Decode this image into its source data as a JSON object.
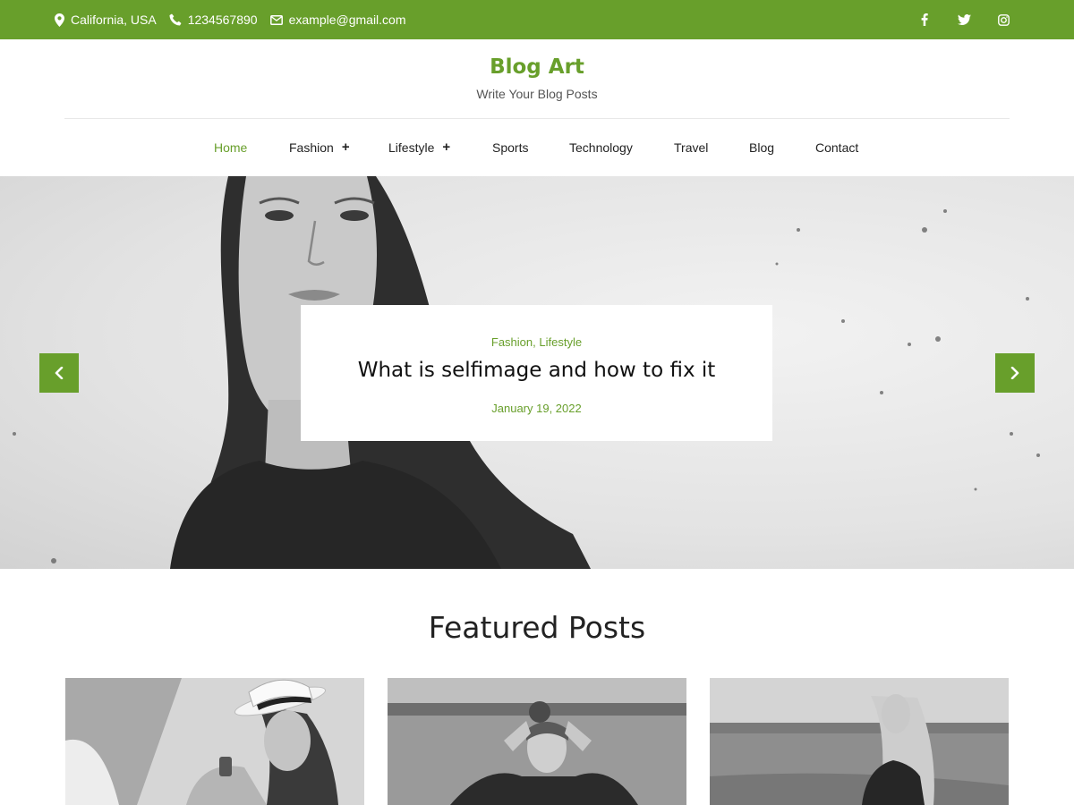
{
  "topbar": {
    "location": "California, USA",
    "phone": "1234567890",
    "email": "example@gmail.com",
    "social": [
      "facebook-icon",
      "twitter-icon",
      "instagram-icon"
    ],
    "bg_color": "#689f2b"
  },
  "site": {
    "title": "Blog Art",
    "tagline": "Write Your Blog Posts",
    "accent": "#689f2b"
  },
  "nav": {
    "items": [
      {
        "label": "Home",
        "active": true
      },
      {
        "label": "Fashion",
        "submenu": true
      },
      {
        "label": "Lifestyle",
        "submenu": true
      },
      {
        "label": "Sports"
      },
      {
        "label": "Technology"
      },
      {
        "label": "Travel"
      },
      {
        "label": "Blog"
      },
      {
        "label": "Contact"
      }
    ],
    "submenu_glyph": "+"
  },
  "hero": {
    "categories": [
      {
        "label": "Fashion"
      },
      {
        "label": "Lifestyle"
      }
    ],
    "category_separator": ",",
    "title": "What is selfimage and how to fix it",
    "date": "January 19, 2022"
  },
  "featured": {
    "heading": "Featured Posts"
  }
}
